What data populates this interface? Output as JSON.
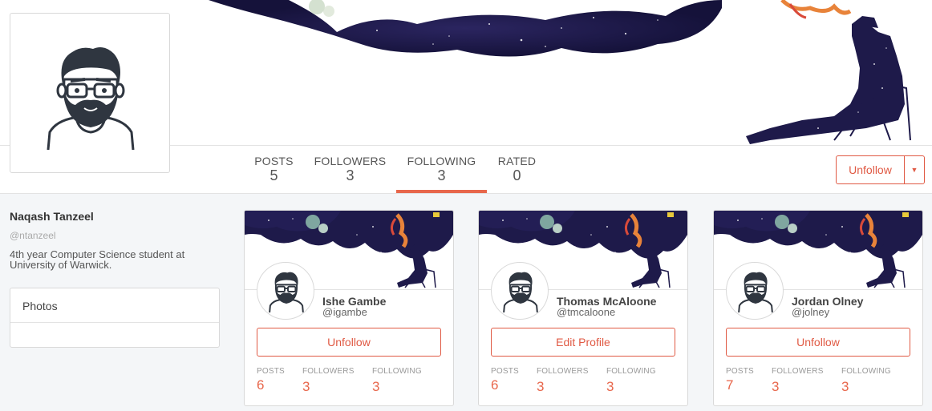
{
  "profile": {
    "name": "Naqash Tanzeel",
    "handle": "@ntanzeel",
    "bio": "4th year Computer Science student at University of Warwick."
  },
  "nav": {
    "posts": {
      "label": "POSTS",
      "value": "5"
    },
    "followers": {
      "label": "FOLLOWERS",
      "value": "3"
    },
    "following": {
      "label": "FOLLOWING",
      "value": "3"
    },
    "rated": {
      "label": "RATED",
      "value": "0"
    },
    "active": "following"
  },
  "actions": {
    "unfollow_label": "Unfollow",
    "caret_icon": "caret-down-icon"
  },
  "sidebar": {
    "photos_label": "Photos"
  },
  "cards": [
    {
      "name": "Ishe Gambe",
      "handle": "@igambe",
      "button": "Unfollow",
      "posts_label": "POSTS",
      "posts": "6",
      "followers_label": "FOLLOWERS",
      "followers": "3",
      "following_label": "FOLLOWING",
      "following": "3"
    },
    {
      "name": "Thomas McAloone",
      "handle": "@tmcaloone",
      "button": "Edit Profile",
      "posts_label": "POSTS",
      "posts": "6",
      "followers_label": "FOLLOWERS",
      "followers": "3",
      "following_label": "FOLLOWING",
      "following": "3"
    },
    {
      "name": "Jordan Olney",
      "handle": "@jolney",
      "button": "Unfollow",
      "posts_label": "POSTS",
      "posts": "7",
      "followers_label": "FOLLOWERS",
      "followers": "3",
      "following_label": "FOLLOWING",
      "following": "3"
    }
  ],
  "colors": {
    "accent": "#e8674c",
    "button_border": "#e05a44",
    "space_dark": "#1e1a4a"
  }
}
